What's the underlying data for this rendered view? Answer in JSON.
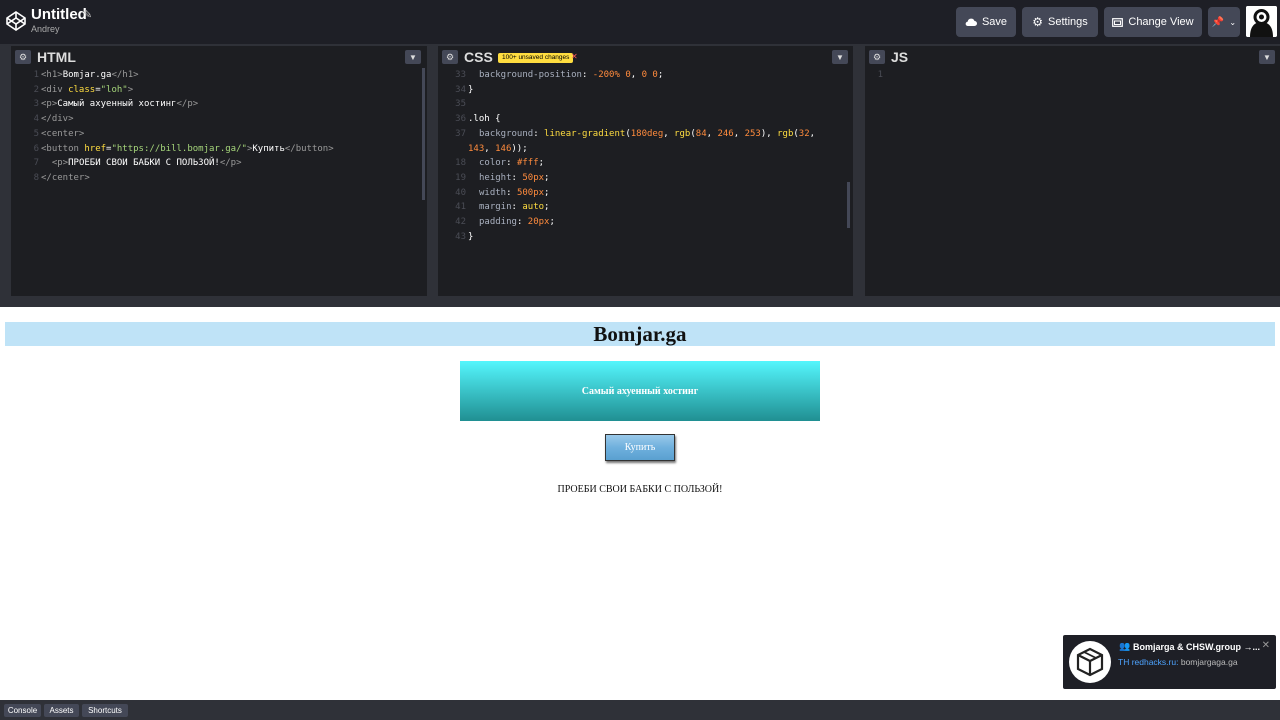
{
  "header": {
    "title": "Untitled",
    "author": "Andrey",
    "buttons": {
      "save": "Save",
      "settings": "Settings",
      "change_view": "Change View"
    }
  },
  "panes": {
    "html": {
      "label": "HTML"
    },
    "css": {
      "label": "CSS",
      "badge": "100+ unsaved changes"
    },
    "js": {
      "label": "JS"
    }
  },
  "preview": {
    "heading": "Bomjar.ga",
    "box_text": "Самый ахуенный хостинг",
    "button": "Купить",
    "paragraph": "ПРОЕБИ СВОИ БАБКИ С ПОЛЬЗОЙ!"
  },
  "notification": {
    "title": "Bomjarga & CHSW.group →...",
    "prefix": "TH redhacks.ru:",
    "link": "bomjargaga.ga"
  },
  "footer": {
    "console": "Console",
    "assets": "Assets",
    "shortcuts": "Shortcuts"
  },
  "icons": [
    "codepen-logo-icon",
    "pencil-icon",
    "cloud-icon",
    "gear-icon",
    "window-icon",
    "pin-icon",
    "chevron-down-icon",
    "avatar-icon",
    "users-icon",
    "close-icon"
  ]
}
